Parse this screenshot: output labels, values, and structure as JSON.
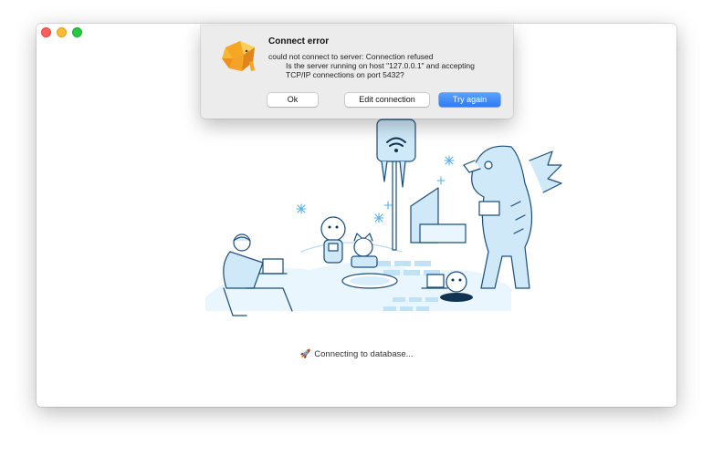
{
  "dialog": {
    "title": "Connect error",
    "message_line1": "could not connect to server: Connection refused",
    "message_line2": "Is the server running on host \"127.0.0.1\" and accepting",
    "message_line3": "TCP/IP connections on port 5432?",
    "buttons": {
      "ok": "Ok",
      "edit": "Edit connection",
      "retry": "Try again"
    },
    "logo_icon": "elephant-logo-icon"
  },
  "status": {
    "text": "Connecting to database...",
    "icon": "rocket-icon"
  },
  "colors": {
    "accent": "#2d7bf5",
    "illustration_stroke": "#1a4d7a",
    "illustration_fill": "#cfe9f9",
    "logo": "#f5a623"
  }
}
